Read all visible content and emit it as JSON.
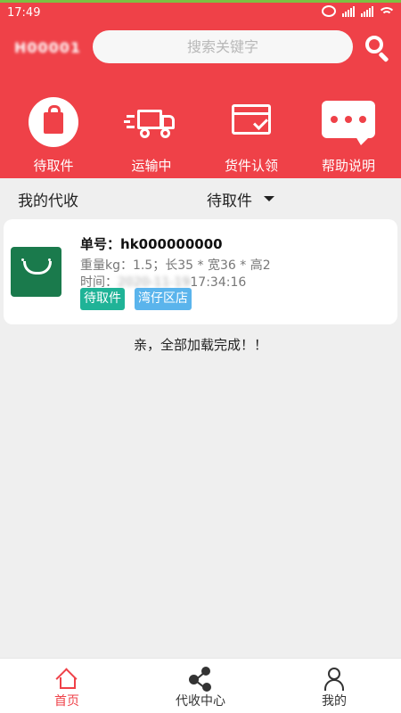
{
  "status_bar": {
    "time": "17:49"
  },
  "header": {
    "user_id": "H00001",
    "search": {
      "placeholder": "搜索关键字"
    }
  },
  "quick_actions": [
    {
      "label": "待取件",
      "icon": "shopping-bag-icon"
    },
    {
      "label": "运输中",
      "icon": "delivery-truck-icon"
    },
    {
      "label": "货件认领",
      "icon": "card-check-icon"
    },
    {
      "label": "帮助说明",
      "icon": "chat-bubble-icon"
    }
  ],
  "filter": {
    "title": "我的代收",
    "selected": "待取件"
  },
  "orders": [
    {
      "number_label": "单号：",
      "number": "hk000000000",
      "weight_line": "重量kg：1.5；长35 * 宽36 * 高2",
      "time_label": "时间：",
      "time_date": "2020-11-19",
      "time_clock": "17:34:16",
      "status_tag": "待取件",
      "store_tag": "湾仔区店"
    }
  ],
  "load_complete": "亲，全部加载完成！！",
  "tabbar": [
    {
      "label": "首页",
      "icon": "home-icon",
      "active": true
    },
    {
      "label": "代收中心",
      "icon": "share-nodes-icon",
      "active": false
    },
    {
      "label": "我的",
      "icon": "user-icon",
      "active": false
    }
  ],
  "colors": {
    "primary": "#ef4148",
    "status_tag": "#1fb397",
    "store_tag": "#5ab4ec"
  }
}
